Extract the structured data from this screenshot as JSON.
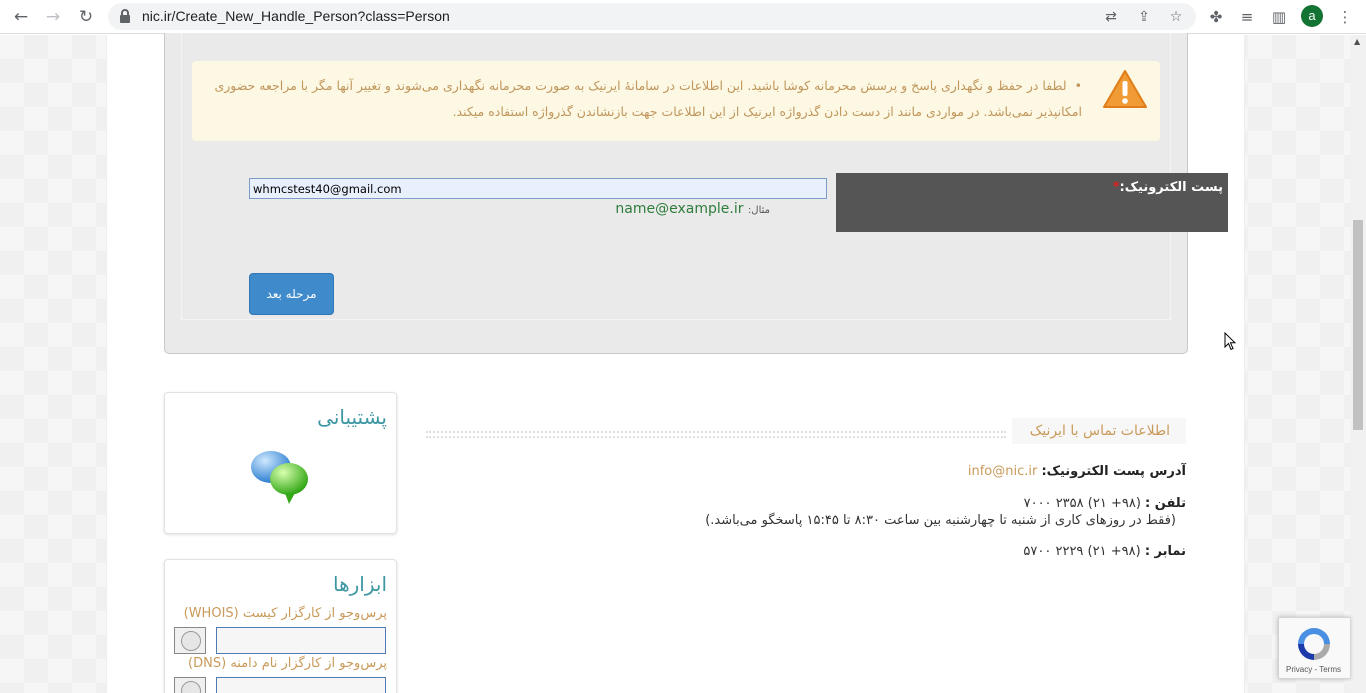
{
  "browser": {
    "url": "nic.ir/Create_New_Handle_Person?class=Person",
    "profile_initial": "a"
  },
  "warning": {
    "text": "لطفا در حفظ و نگهداری پاسخ و پرسش محرمانه کوشا باشید. این اطلاعات در سامانهٔ ایرنیک به صورت محرمانه نگهداری می‌شوند و تغییر آنها مگر با مراجعه حضوری امکانپذیر نمی‌باشد. در مواردی مانند از دست دادن گذرواژه ایرنیک از این اطلاعات جهت بازنشاندن گذرواژه استفاده میکند."
  },
  "form": {
    "email_label": "پست الکترونیک:",
    "required_mark": "*",
    "email_value": "whmcstest40@gmail.com",
    "example_label": "مثال:",
    "example_value": "name@example.ir",
    "next_button": "مرحله بعد"
  },
  "contact": {
    "title": "اطلاعات تماس با ایرنیک",
    "email_label": "آدرس پست الکترونیک:",
    "email_value": "info@nic.ir",
    "phone_label": "تلفن :",
    "phone_value": "(۹۸+ ۲۱) ۲۳۵۸ ۷۰۰۰",
    "phone_note": "(فقط در روزهای کاری از شنبه تا چهارشنبه بین ساعت ۸:۳۰ تا ۱۵:۴۵ پاسخگو می‌باشد.)",
    "fax_label": "نمابر :",
    "fax_value": "(۹۸+ ۲۱) ۲۲۲۹ ۵۷۰۰"
  },
  "support": {
    "title": "پشتیبانی"
  },
  "tools": {
    "title": "ابزارها",
    "whois_label": "پرس‌وجو از کارگزار کیست (WHOIS)",
    "dns_label": "پرس‌وجو از کارگزار نام دامنه (DNS)"
  },
  "recaptcha": {
    "privacy": "Privacy",
    "sep": " - ",
    "terms": "Terms"
  }
}
